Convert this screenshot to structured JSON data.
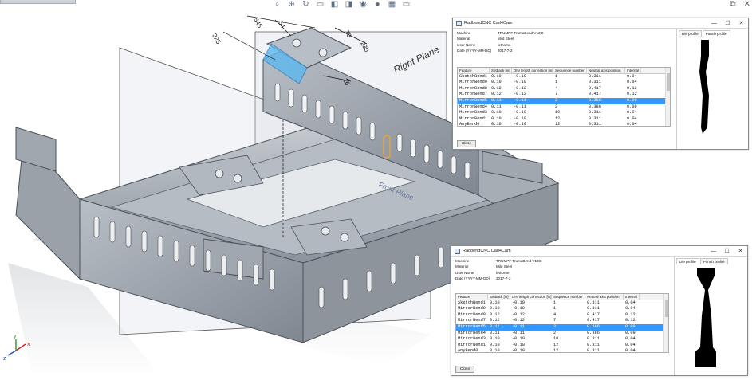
{
  "viewport": {
    "plane_labels": {
      "right": "Right Plane",
      "front": "Front Plane"
    },
    "dimensions": [
      "325",
      "545",
      "54",
      "70",
      "230",
      "16"
    ],
    "axis_labels": {
      "x": "x",
      "y": "y",
      "z": "z"
    },
    "colors": {
      "part": "#9ea5ae",
      "highlight": "#3aa7e8",
      "orange": "#f0a23a"
    }
  },
  "toolbar": {
    "icons": [
      "search-icon",
      "zoom-icon",
      "rotate-icon",
      "section-icon",
      "view-icon",
      "display-icon",
      "hide-icon",
      "appearance-icon",
      "scene-icon",
      "monitor-icon"
    ]
  },
  "dialogs": [
    {
      "title": "RadbendCNC Cad4Cam",
      "controls": [
        "—",
        "☐",
        "✕"
      ],
      "info": [
        {
          "label": "Machine",
          "value": "TRUMPF TrumaBend V130t"
        },
        {
          "label": "Material",
          "value": "Mild Steel"
        },
        {
          "label": "User Name",
          "value": "lothorne"
        },
        {
          "label": "Date (YYYY-MM-DD)",
          "value": "2017-7-3"
        }
      ],
      "columns": [
        "Feature",
        "Setback [in]",
        "DIN length correction [in]",
        "Sequence number",
        "Neutral axis position",
        "Internal"
      ],
      "rows": [
        [
          "SketchBend1",
          "0.10",
          "-0.10",
          "1",
          "0.311",
          "0.04"
        ],
        [
          "MirrorBend9",
          "0.10",
          "-0.10",
          "1",
          "0.311",
          "0.04"
        ],
        [
          "MirrorBend8",
          "0.12",
          "-0.12",
          "4",
          "0.417",
          "0.12"
        ],
        [
          "MirrorBend7",
          "0.12",
          "-0.12",
          "7",
          "0.417",
          "0.12"
        ],
        [
          "MirrorBend5",
          "0.11",
          "-0.11",
          "2",
          "0.386",
          "0.09"
        ],
        [
          "MirrorBend4",
          "0.11",
          "-0.11",
          "2",
          "0.386",
          "0.09"
        ],
        [
          "MirrorBend3",
          "0.10",
          "-0.10",
          "10",
          "0.311",
          "0.04"
        ],
        [
          "MirrorBend1",
          "0.10",
          "-0.10",
          "12",
          "0.311",
          "0.04"
        ],
        [
          "AnyBend0",
          "0.10",
          "-0.10",
          "12",
          "0.311",
          "0.04"
        ]
      ],
      "selected_row": 4,
      "close_label": "Close",
      "tabs": [
        "Die profile",
        "Punch profile"
      ],
      "active_tab": 1
    },
    {
      "title": "RadbendCNC Cad4Cam",
      "controls": [
        "—",
        "☐",
        "✕"
      ],
      "info": [
        {
          "label": "Machine",
          "value": "TRUMPF TrumaBend V130t"
        },
        {
          "label": "Material",
          "value": "Mild Steel"
        },
        {
          "label": "User Name",
          "value": "lothorne"
        },
        {
          "label": "Date (YYYY-MM-DD)",
          "value": "2017-7-3"
        }
      ],
      "columns": [
        "Feature",
        "Setback [in]",
        "DIN length correction [in]",
        "Sequence number",
        "Neutral axis position",
        "Internal"
      ],
      "rows": [
        [
          "SketchBend1",
          "0.10",
          "-0.10",
          "1",
          "0.311",
          "0.04"
        ],
        [
          "MirrorBend9",
          "0.10",
          "-0.10",
          "1",
          "0.311",
          "0.04"
        ],
        [
          "MirrorBend8",
          "0.12",
          "-0.12",
          "4",
          "0.417",
          "0.12"
        ],
        [
          "MirrorBend7",
          "0.12",
          "-0.12",
          "7",
          "0.417",
          "0.12"
        ],
        [
          "MirrorBend5",
          "0.11",
          "-0.11",
          "2",
          "0.386",
          "0.09"
        ],
        [
          "MirrorBend4",
          "0.11",
          "-0.11",
          "2",
          "0.386",
          "0.09"
        ],
        [
          "MirrorBend3",
          "0.10",
          "-0.10",
          "10",
          "0.311",
          "0.04"
        ],
        [
          "MirrorBend1",
          "0.10",
          "-0.10",
          "12",
          "0.311",
          "0.04"
        ],
        [
          "AnyBend0",
          "0.10",
          "-0.10",
          "12",
          "0.311",
          "0.04"
        ]
      ],
      "selected_row": 4,
      "close_label": "Close",
      "tabs": [
        "Die profile",
        "Punch profile"
      ],
      "active_tab": 0
    }
  ]
}
